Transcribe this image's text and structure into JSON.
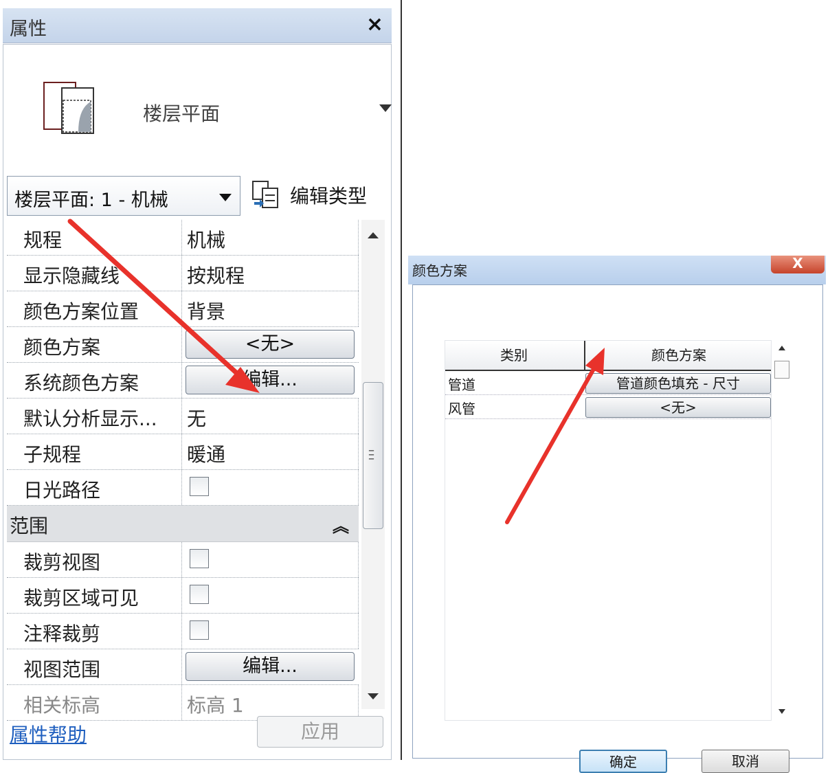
{
  "properties": {
    "title": "属性",
    "close_label": "×",
    "type_name": "楼层平面",
    "instance_selector": "楼层平面: 1 - 机械",
    "edit_type_label": "编辑类型",
    "rows": [
      {
        "key": "规程",
        "value": "机械"
      },
      {
        "key": "显示隐藏线",
        "value": "按规程"
      },
      {
        "key": "颜色方案位置",
        "value": "背景"
      },
      {
        "key": "颜色方案",
        "button": "<无>"
      },
      {
        "key": "系统颜色方案",
        "button": "编辑..."
      },
      {
        "key": "默认分析显示...",
        "value": "无"
      },
      {
        "key": "子规程",
        "value": "暖通"
      },
      {
        "key": "日光路径",
        "checked": false
      }
    ],
    "group": {
      "label": "范围",
      "collapse_icon": "⌃"
    },
    "group_rows": [
      {
        "key": "裁剪视图",
        "checked": false
      },
      {
        "key": "裁剪区域可见",
        "checked": false
      },
      {
        "key": "注释裁剪",
        "checked": false
      },
      {
        "key": "视图范围",
        "button": "编辑..."
      },
      {
        "key": "相关标高",
        "value": "标高 1"
      }
    ],
    "help_link": "属性帮助",
    "apply_label": "应用"
  },
  "dialog": {
    "title": "颜色方案",
    "close_label": "X",
    "col_category": "类别",
    "col_scheme": "颜色方案",
    "rows": [
      {
        "category": "管道",
        "scheme": "管道颜色填充 - 尺寸"
      },
      {
        "category": "风管",
        "scheme": "<无>"
      }
    ],
    "ok_label": "确定",
    "cancel_label": "取消"
  },
  "colors": {
    "annotation_arrow": "#e8322b",
    "link": "#1f5fbf",
    "title_bar": "#c4d4ea"
  }
}
